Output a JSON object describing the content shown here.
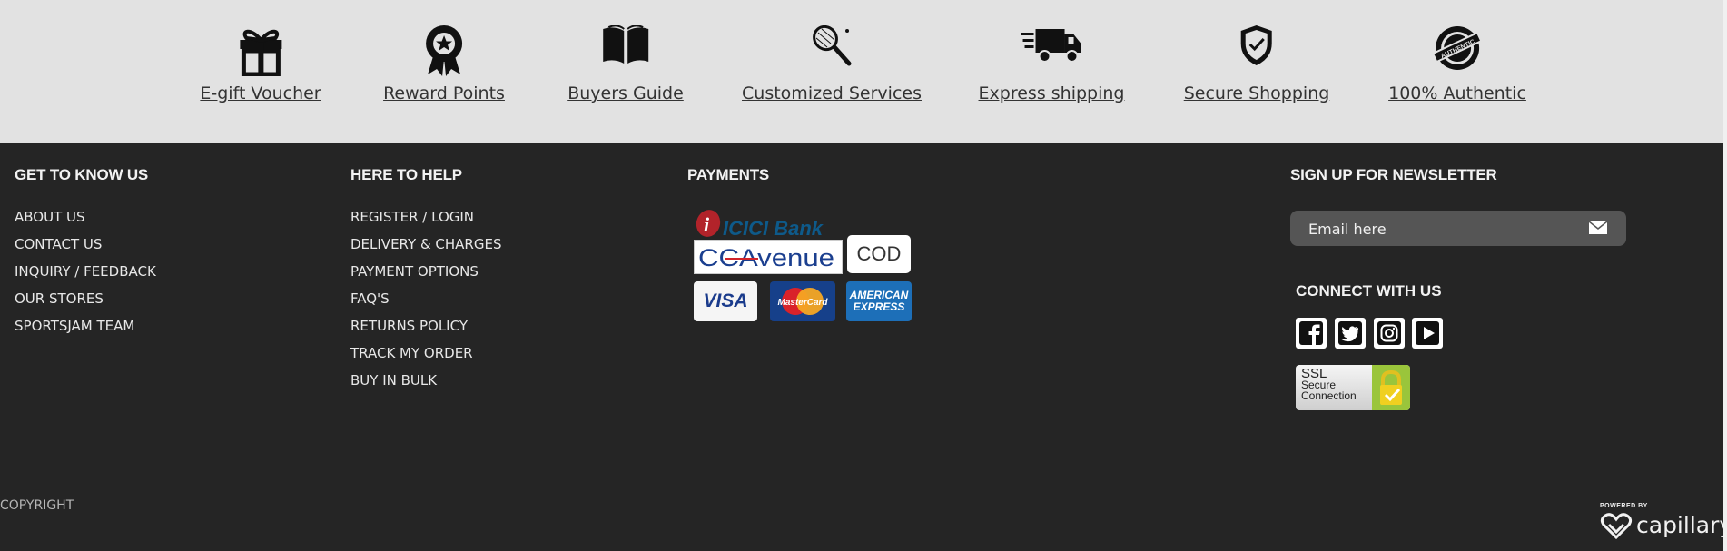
{
  "features": [
    {
      "label": "E-gift Voucher",
      "icon": "gift-icon"
    },
    {
      "label": "Reward Points",
      "icon": "award-badge-icon"
    },
    {
      "label": "Buyers Guide",
      "icon": "open-book-icon"
    },
    {
      "label": "Customized Services",
      "icon": "racket-icon"
    },
    {
      "label": "Express shipping",
      "icon": "truck-icon"
    },
    {
      "label": "Secure Shopping",
      "icon": "shield-check-icon"
    },
    {
      "label": "100% Authentic",
      "icon": "authentic-seal-icon"
    }
  ],
  "footer": {
    "get_to_know": {
      "heading": "GET TO KNOW US",
      "links": [
        "ABOUT US",
        "CONTACT US",
        "INQUIRY / FEEDBACK",
        "OUR STORES",
        "SPORTSJAM TEAM"
      ]
    },
    "here_to_help": {
      "heading": "HERE TO HELP",
      "links": [
        "REGISTER / LOGIN",
        "DELIVERY & CHARGES",
        "PAYMENT OPTIONS",
        "FAQ'S",
        "RETURNS POLICY",
        "TRACK MY ORDER",
        "BUY IN BULK"
      ]
    },
    "payments": {
      "heading": "PAYMENTS",
      "logos": {
        "icici": "ICICI Bank",
        "ccavenue": "CCAvenue",
        "cod": "COD",
        "visa": "VISA",
        "mastercard": "MasterCard",
        "amex_line1": "AMERICAN",
        "amex_line2": "EXPRESS"
      }
    },
    "newsletter": {
      "heading": "SIGN UP FOR NEWSLETTER",
      "placeholder": "Email here",
      "submit_icon": "envelope-icon"
    },
    "connect": {
      "heading": "CONNECT WITH US",
      "networks": [
        "facebook-icon",
        "twitter-icon",
        "instagram-icon",
        "youtube-icon"
      ]
    },
    "ssl": {
      "line1": "SSL",
      "line2": "Secure",
      "line3": "Connection"
    },
    "copyright": "COPYRIGHT",
    "powered": {
      "small": "POWERED BY",
      "brand": "capillary"
    }
  },
  "colors": {
    "footer_bg": "#252525",
    "feature_bar_bg": "#e2e2e2",
    "feature_text": "#333333",
    "footer_text": "#e8e8e8",
    "ssl_green": "#9ac53b"
  }
}
